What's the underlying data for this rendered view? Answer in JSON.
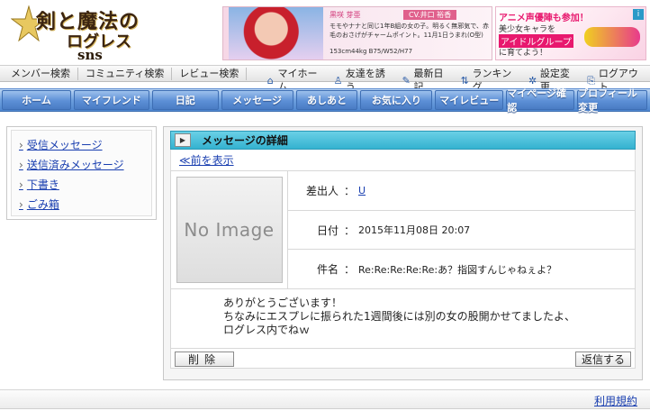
{
  "logo": {
    "line1": "剣と魔法の",
    "line2": "ログレス",
    "line3": "sns"
  },
  "banner1": {
    "name": "黒咲 芽亜",
    "cv": "CV.井口 裕香",
    "desc": "モモやナナと同じ1年B組の女の子。明るく無邪気で、赤毛のおさげがチャームポイント。11月1日うまれ(O型)",
    "stats": "153cm44kg B75/W52/H77"
  },
  "banner2": {
    "line1": "アニメ声優陣も参加！",
    "line2": "美少女キャラを",
    "line3": "アイドルグループ",
    "line4": "に育てよう！"
  },
  "subnav": {
    "left": [
      "メンバー検索",
      "コミュニティ検索",
      "レビュー検索"
    ],
    "right": [
      {
        "icon": "home-icon",
        "glyph": "⌂",
        "label": "マイホーム"
      },
      {
        "icon": "invite-icon",
        "glyph": "♙",
        "label": "友達を誘う"
      },
      {
        "icon": "pencil-icon",
        "glyph": "✎",
        "label": "最新日記"
      },
      {
        "icon": "ranking-icon",
        "glyph": "⇅",
        "label": "ランキング"
      },
      {
        "icon": "gear-icon",
        "glyph": "✲",
        "label": "設定変更"
      },
      {
        "icon": "logout-icon",
        "glyph": "⎘",
        "label": "ログアウト"
      }
    ]
  },
  "mainnav": [
    "ホーム",
    "マイフレンド",
    "日記",
    "メッセージ",
    "あしあと",
    "お気に入り",
    "マイレビュー",
    "マイページ確認",
    "プロフィール変更"
  ],
  "sidebar": {
    "bullet": "›",
    "items": [
      "受信メッセージ",
      "送信済みメッセージ",
      "下書き",
      "ごみ箱"
    ]
  },
  "message": {
    "panel_title": "メッセージの詳細",
    "back_link": "≪前を表示",
    "no_image": "No Image",
    "sender_label": "差出人",
    "sender_value": "U",
    "date_label": "日付",
    "date_value": "2015年11月08日 20:07",
    "subject_label": "件名",
    "subject_value": "Re:Re:Re:Re:Re:あ？指図すんじゃねぇよ？",
    "separator": "：",
    "body_lines": [
      "ありがとうございます！",
      "ちなみにエスプレに振られた1週間後には別の女の股開かせてましたよ、",
      "ログレス内でねｗ"
    ],
    "delete_button": "削除",
    "reply_button": "返信する"
  },
  "footer": {
    "terms_link": "利用規約"
  },
  "colors": {
    "nav_blue": "#5c8fd6",
    "panel_title_cyan": "#34b2d0",
    "link_blue": "#1a3fb0"
  }
}
